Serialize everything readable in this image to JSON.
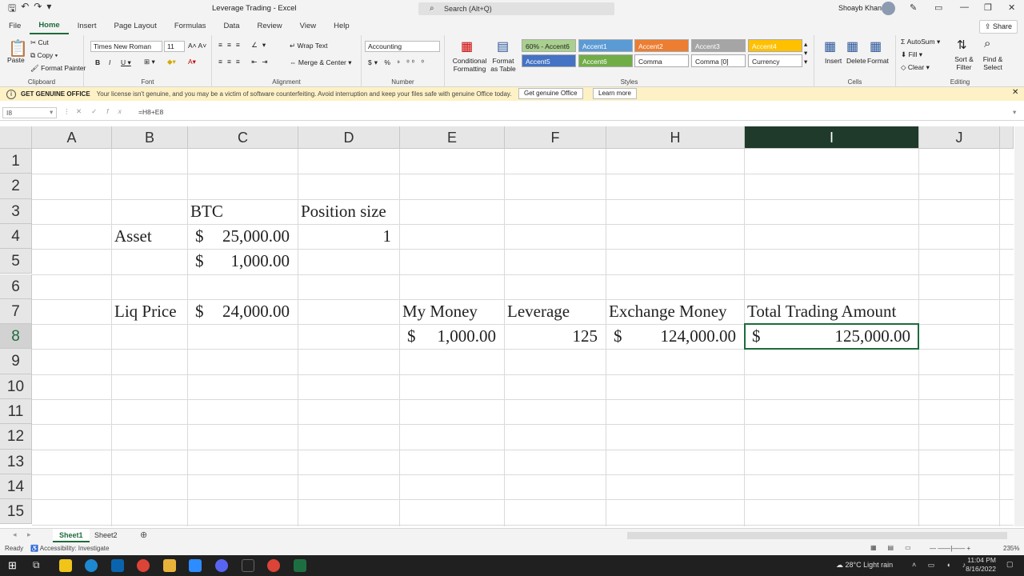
{
  "window": {
    "title": "Leverage Trading - Excel",
    "search_placeholder": "Search (Alt+Q)",
    "user": "Shoayb Khan"
  },
  "tabs": [
    "File",
    "Home",
    "Insert",
    "Page Layout",
    "Formulas",
    "Data",
    "Review",
    "View",
    "Help"
  ],
  "share_label": "Share",
  "ribbon": {
    "clipboard": {
      "label": "Clipboard",
      "paste": "Paste",
      "cut": "Cut",
      "copy": "Copy",
      "format_painter": "Format Painter"
    },
    "font": {
      "label": "Font",
      "family": "Times New Roman",
      "size": "11"
    },
    "alignment": {
      "label": "Alignment",
      "wrap": "Wrap Text",
      "merge": "Merge & Center"
    },
    "number": {
      "label": "Number",
      "format": "Accounting"
    },
    "styles": {
      "label": "Styles",
      "conditional": "Conditional Formatting",
      "format_table": "Format as Table",
      "cells": [
        {
          "name": "60% - Accent6",
          "bg": "#a9d08e"
        },
        {
          "name": "Accent1",
          "bg": "#5b9bd5"
        },
        {
          "name": "Accent2",
          "bg": "#ed7d31"
        },
        {
          "name": "Accent3",
          "bg": "#a5a5a5"
        },
        {
          "name": "Accent4",
          "bg": "#ffc000"
        },
        {
          "name": "Accent5",
          "bg": "#4472c4"
        },
        {
          "name": "Accent6",
          "bg": "#70ad47"
        },
        {
          "name": "Comma",
          "bg": "#ffffff"
        },
        {
          "name": "Comma [0]",
          "bg": "#ffffff"
        },
        {
          "name": "Currency",
          "bg": "#ffffff"
        }
      ]
    },
    "cells": {
      "label": "Cells",
      "insert": "Insert",
      "delete": "Delete",
      "format": "Format"
    },
    "editing": {
      "label": "Editing",
      "autosum": "AutoSum",
      "fill": "Fill",
      "clear": "Clear",
      "sort": "Sort & Filter",
      "find": "Find & Select"
    }
  },
  "genuine": {
    "title": "GET GENUINE OFFICE",
    "message": "Your license isn't genuine, and you may be a victim of software counterfeiting. Avoid interruption and keep your files safe with genuine Office today.",
    "btn1": "Get genuine Office",
    "btn2": "Learn more"
  },
  "formula_bar": {
    "name_box": "I8",
    "formula": "=H8+E8"
  },
  "columns": [
    "A",
    "B",
    "C",
    "D",
    "E",
    "F",
    "H",
    "I",
    "J"
  ],
  "rows": [
    "1",
    "2",
    "3",
    "4",
    "5",
    "6",
    "7",
    "8",
    "9",
    "10",
    "11",
    "12",
    "13",
    "14",
    "15"
  ],
  "cells": {
    "C3": "BTC",
    "D3": "Position size",
    "B4": "Asset",
    "C4_sym": "$",
    "C4": "25,000.00",
    "D4": "1",
    "C5_sym": "$",
    "C5": "1,000.00",
    "B7": "Liq Price",
    "C7_sym": "$",
    "C7": "24,000.00",
    "E7": "My Money",
    "F7": "Leverage",
    "H7": "Exchange Money",
    "I7": "Total Trading Amount",
    "E8_sym": "$",
    "E8": "1,000.00",
    "F8": "125",
    "H8_sym": "$",
    "H8": "124,000.00",
    "I8_sym": "$",
    "I8": "125,000.00"
  },
  "sheets": [
    "Sheet1",
    "Sheet2"
  ],
  "status": {
    "ready": "Ready",
    "accessibility": "Accessibility: Investigate",
    "zoom": "235%"
  },
  "taskbar": {
    "weather": "28°C  Light rain",
    "time": "11:04 PM",
    "date": "8/16/2022"
  }
}
